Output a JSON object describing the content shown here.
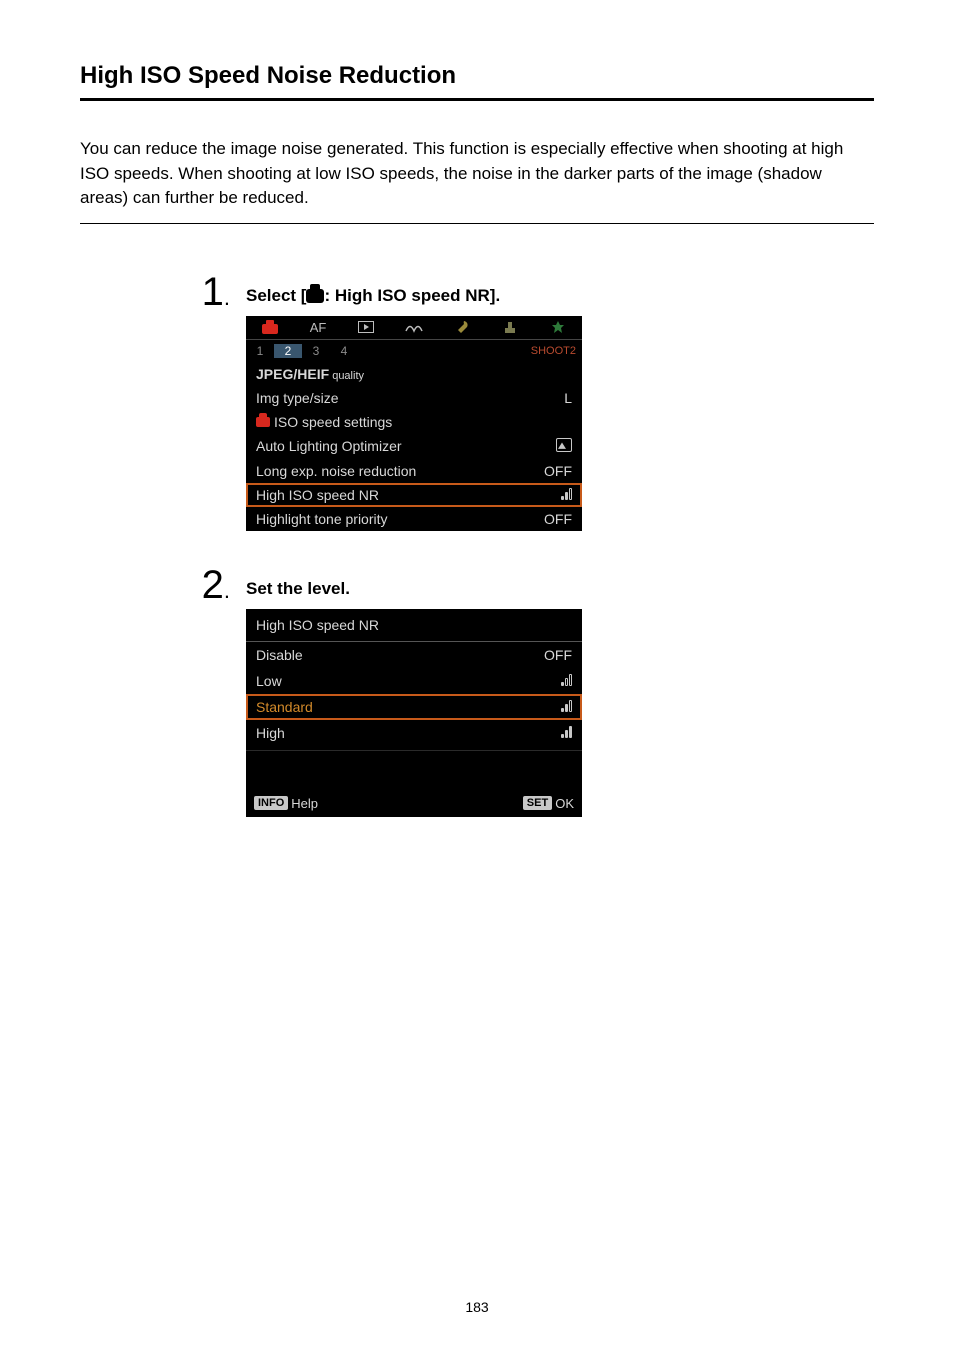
{
  "page_number": "183",
  "title": "High ISO Speed Noise Reduction",
  "intro": "You can reduce the image noise generated. This function is especially effective when shooting at high ISO speeds. When shooting at low ISO speeds, the noise in the darker parts of the image (shadow areas) can further be reduced.",
  "step1": {
    "number": "1",
    "label_prefix": "Select [",
    "label_suffix": ": High ISO speed NR].",
    "tabs": {
      "af": "AF",
      "subnums": [
        "1",
        "2",
        "3",
        "4"
      ],
      "pagename": "SHOOT2"
    },
    "rows": [
      {
        "label_html": "<span class='jpeg-seg'><span class='hi'>JPEG/HEIF</span> quality</span>",
        "value": ""
      },
      {
        "label": "Img type/size",
        "value": "L"
      },
      {
        "label_html": "<span class='cam-ico'></span>ISO speed settings",
        "value": ""
      },
      {
        "label": "Auto Lighting Optimizer",
        "value_icon": "alo"
      },
      {
        "label": "Long exp. noise reduction",
        "value": "OFF"
      },
      {
        "label": "High ISO speed NR",
        "value_icon": "bars-std",
        "selected": true
      },
      {
        "label": "Highlight tone priority",
        "value": "OFF"
      }
    ]
  },
  "step2": {
    "number": "2",
    "label": "Set the level.",
    "heading": "High ISO speed NR",
    "options": [
      {
        "label": "Disable",
        "value_text": "OFF"
      },
      {
        "label": "Low",
        "value_icon": "bars-low"
      },
      {
        "label": "Standard",
        "value_icon": "bars-std",
        "selected": true
      },
      {
        "label": "High",
        "value_icon": "bars-high"
      }
    ],
    "footer": {
      "info_badge": "INFO",
      "info_text": "Help",
      "set_badge": "SET",
      "set_text": "OK"
    }
  }
}
